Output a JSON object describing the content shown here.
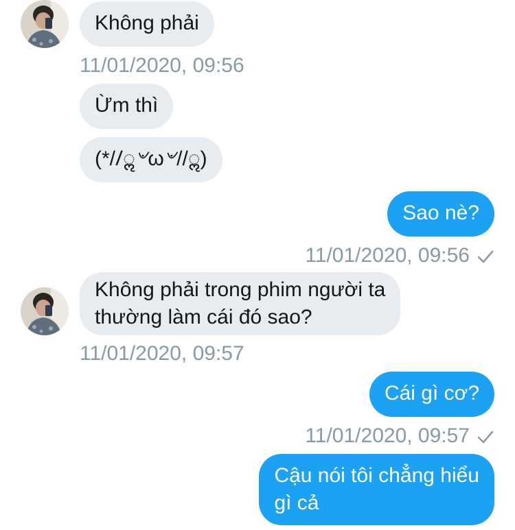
{
  "conversation": {
    "messages": [
      {
        "side": "in",
        "text": "Không phải"
      },
      {
        "side": "in",
        "text": "Ừm thì"
      },
      {
        "side": "in",
        "text": "(*//ॢ৺ω৺//ॢ)"
      },
      {
        "side": "out",
        "text": "Sao nè?"
      },
      {
        "side": "in",
        "line1": "Không phải trong phim người ta",
        "line2": "thường làm cái đó sao?"
      },
      {
        "side": "out",
        "text": "Cái gì cơ?"
      },
      {
        "side": "out",
        "line1": "Cậu nói tôi chẳng hiểu",
        "line2": "gì cả"
      }
    ],
    "timestamps": [
      "11/01/2020, 09:56",
      "11/01/2020, 09:56",
      "11/01/2020, 09:57",
      "11/01/2020, 09:57"
    ]
  },
  "colors": {
    "incoming_bubble": "#e6ecf0",
    "outgoing_bubble": "#1da1f2",
    "timestamp_text": "#8899a6"
  },
  "icons": {
    "avatar": "contact-avatar-photo",
    "sent": "checkmark-icon"
  }
}
